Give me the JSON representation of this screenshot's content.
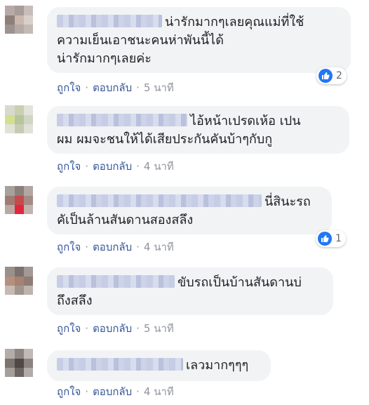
{
  "actions": {
    "like": "ถูกใจ",
    "reply": "ตอบกลับ",
    "separator": "·"
  },
  "colors": {
    "bubble": "#f2f3f5",
    "action_link": "#385898",
    "time": "#90949c",
    "reaction_icon": "#2078f4"
  },
  "comments": [
    {
      "lines": [
        "น่ารักมากๆเลยคุณแม่ที่ใช้",
        "ความเย็นเอาชนะคนห่าพันนี้ได้",
        "น่ารักมากๆเลยค่ะ"
      ],
      "time": "5 นาที",
      "reaction": {
        "icon": "like-icon",
        "count": "2"
      }
    },
    {
      "lines": [
        "ไอ้หน้าเปรดเห้อ เปน",
        "ผม ผมจะชนให้ได้เสียประกันคันบ้าๆกับกู"
      ],
      "time": "4 นาที"
    },
    {
      "lines": [
        "นี่สินะรถ",
        "คัเป็นล้านสันดานสองสลึง"
      ],
      "time": "4 นาที",
      "reaction": {
        "icon": "like-icon",
        "count": "1"
      }
    },
    {
      "lines": [
        "ขับรถเป็นบ้านสันดานบ่",
        "ถึงสลึง"
      ],
      "time": "5 นาที"
    },
    {
      "lines": [
        "เลวมากๆๆๆ"
      ],
      "time": "4 นาที"
    }
  ]
}
